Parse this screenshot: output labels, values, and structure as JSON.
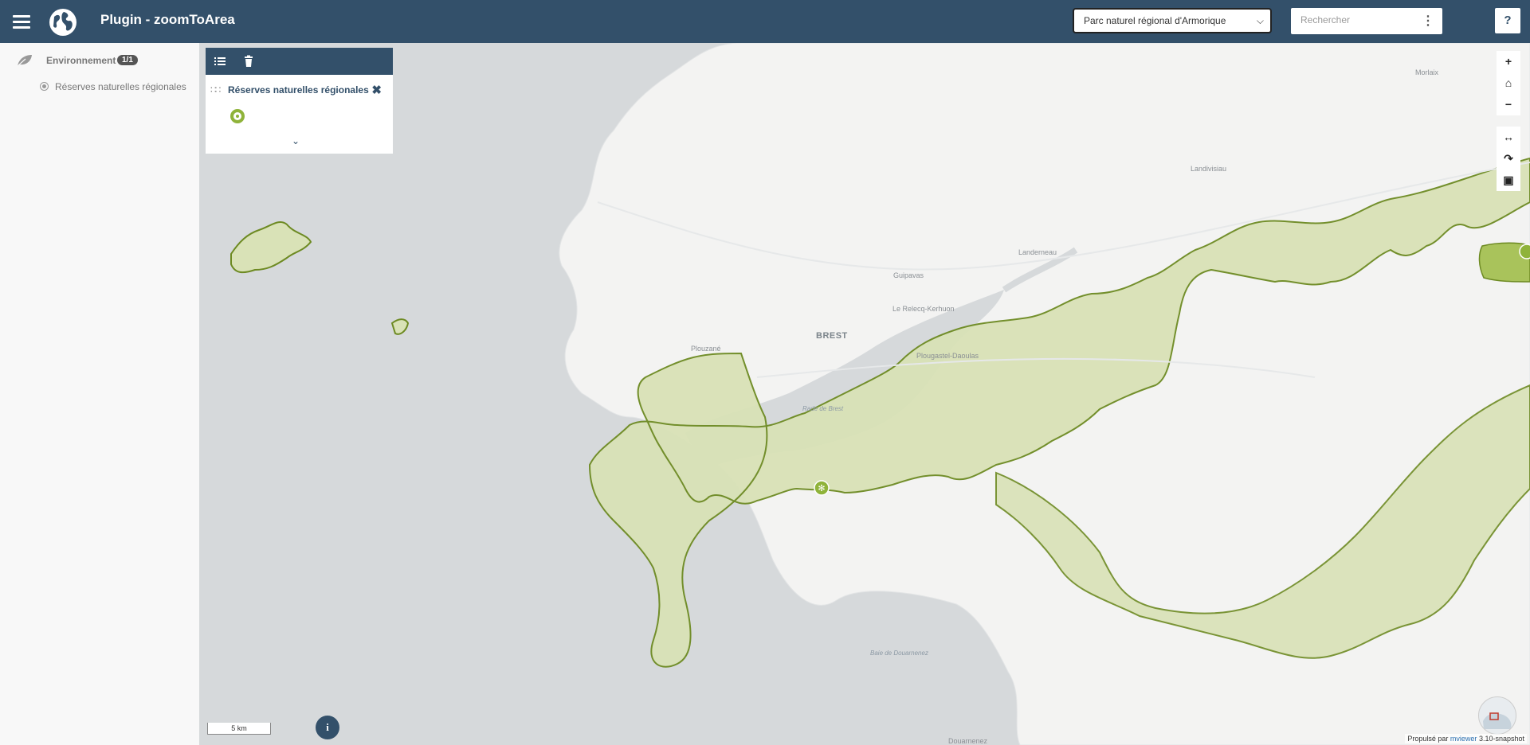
{
  "header": {
    "app_title": "Plugin - zoomToArea",
    "area_select": "Parc naturel régional d'Armorique",
    "search_placeholder": "Rechercher",
    "help_label": "?"
  },
  "sidebar": {
    "theme_name": "Environnement",
    "theme_badge": "1/1",
    "layer_name": "Réserves naturelles régionales"
  },
  "legend": {
    "layer_title": "Réserves naturelles régionales"
  },
  "map": {
    "place_labels": [
      "Morlaix",
      "Landivisiau",
      "Landerneau",
      "Guipavas",
      "Le Relecq-Kerhuon",
      "BREST",
      "Plouzané",
      "Plougastel-Daoulas",
      "Rade de Brest",
      "Baie de Douarnenez",
      "Douarnenez"
    ],
    "scale_label": "5 km",
    "info_label": "i",
    "attribution_prefix": "Propulsé par",
    "attribution_link": "mviewer",
    "attribution_suffix": "3.10-snapshot",
    "colors": {
      "area_fill": "#d9e2b7",
      "area_stroke": "#6d8a22",
      "water": "#d6d9db",
      "land": "#f3f3f2",
      "marker": "#8fb33a"
    }
  }
}
